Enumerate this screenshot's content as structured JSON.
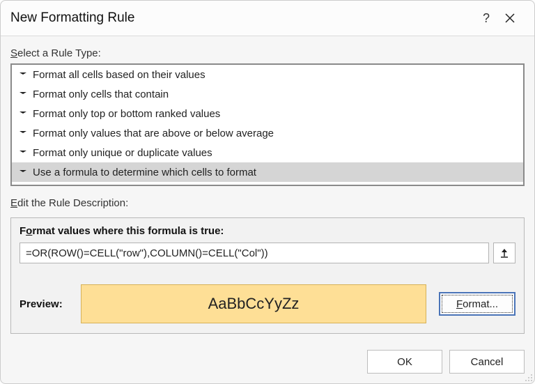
{
  "dialog": {
    "title": "New Formatting Rule",
    "select_label": "Select a Rule Type:",
    "edit_label": "Edit the Rule Description:"
  },
  "rule_types": [
    {
      "label": "Format all cells based on their values",
      "selected": false
    },
    {
      "label": "Format only cells that contain",
      "selected": false
    },
    {
      "label": "Format only top or bottom ranked values",
      "selected": false
    },
    {
      "label": "Format only values that are above or below average",
      "selected": false
    },
    {
      "label": "Format only unique or duplicate values",
      "selected": false
    },
    {
      "label": "Use a formula to determine which cells to format",
      "selected": true
    }
  ],
  "formula": {
    "label": "Format values where this formula is true:",
    "value": "=OR(ROW()=CELL(\"row\"),COLUMN()=CELL(\"Col\"))"
  },
  "preview": {
    "label": "Preview:",
    "sample_text": "AaBbCcYyZz",
    "fill_color": "#fedf96",
    "border_color": "#d6b158",
    "format_button": "Format..."
  },
  "buttons": {
    "ok": "OK",
    "cancel": "Cancel"
  }
}
